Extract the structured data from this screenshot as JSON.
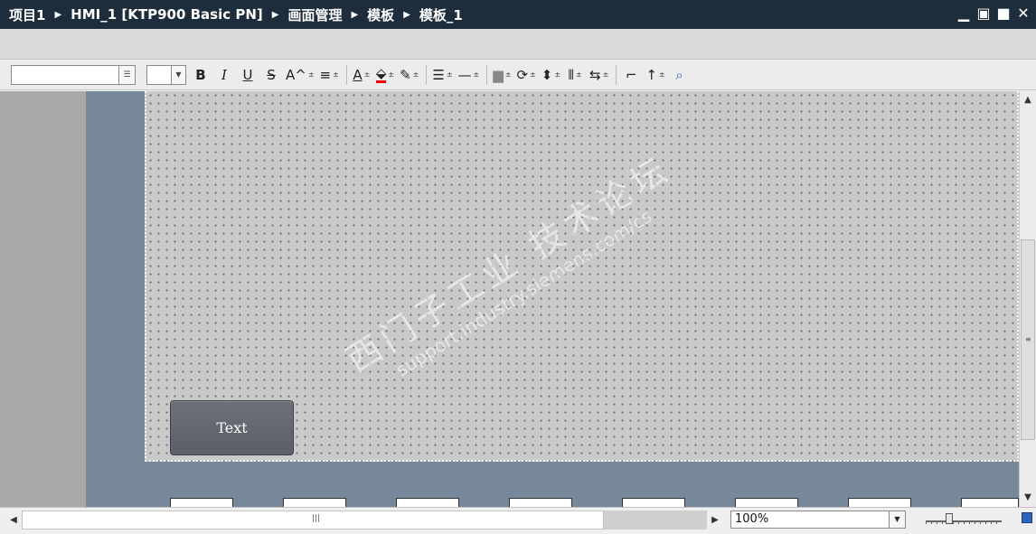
{
  "breadcrumb": [
    "项目1",
    "HMI_1 [KTP900 Basic PN]",
    "画面管理",
    "模板",
    "模板_1"
  ],
  "window_controls": {
    "minimize": "▁",
    "restore": "▣",
    "maximize": "■",
    "close": "✕"
  },
  "toolbar": {
    "font_name": "",
    "font_size": "",
    "bold": "B",
    "italic": "I",
    "underline": "U",
    "strikethrough": "S",
    "text_size": "A^",
    "align": "≡",
    "font_color": "A",
    "fill_color": "⬙",
    "line_color": "✎",
    "line_width": "☰",
    "line_style": "—",
    "layer": "▆",
    "rotate": "⟳",
    "align_objects": "⬍",
    "distribute": "⫴",
    "same_size": "⇆",
    "format_painter": "⌐",
    "tab_order": "↑",
    "zoom_select": "⌕"
  },
  "canvas": {
    "template_button_text": "Text",
    "watermark_cn": "西门子工业 技术论坛",
    "watermark_url": "support.industry.siemens.com/cs"
  },
  "status": {
    "zoom_value": "100%"
  },
  "colors": {
    "titlebar": "#1e2d3b",
    "slate": "#77889a",
    "canvas": "#c9c9c9"
  }
}
